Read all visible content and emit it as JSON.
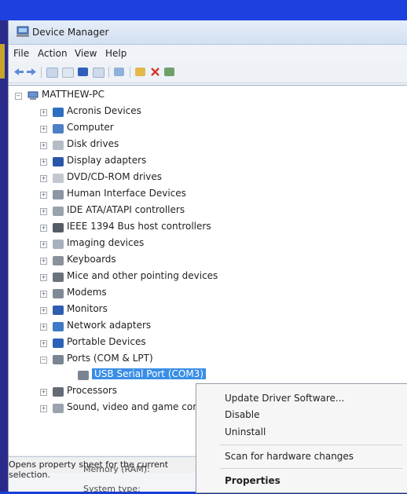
{
  "window": {
    "title": "Device Manager"
  },
  "menu": [
    "File",
    "Action",
    "View",
    "Help"
  ],
  "tree": {
    "root": "MATTHEW-PC",
    "items": [
      "Acronis Devices",
      "Computer",
      "Disk drives",
      "Display adapters",
      "DVD/CD-ROM drives",
      "Human Interface Devices",
      "IDE ATA/ATAPI controllers",
      "IEEE 1394 Bus host controllers",
      "Imaging devices",
      "Keyboards",
      "Mice and other pointing devices",
      "Modems",
      "Monitors",
      "Network adapters",
      "Portable Devices",
      "Ports (COM & LPT)"
    ],
    "child_selected": "USB Serial Port (COM3)",
    "after_items": [
      "Processors",
      "Sound, video and game controllers"
    ]
  },
  "context_menu": [
    "Update Driver Software...",
    "Disable",
    "Uninstall",
    "Scan for hardware changes",
    "Properties"
  ],
  "status": "Opens property sheet for the current selection.",
  "background": [
    "Memory (RAM):",
    "System type:"
  ]
}
